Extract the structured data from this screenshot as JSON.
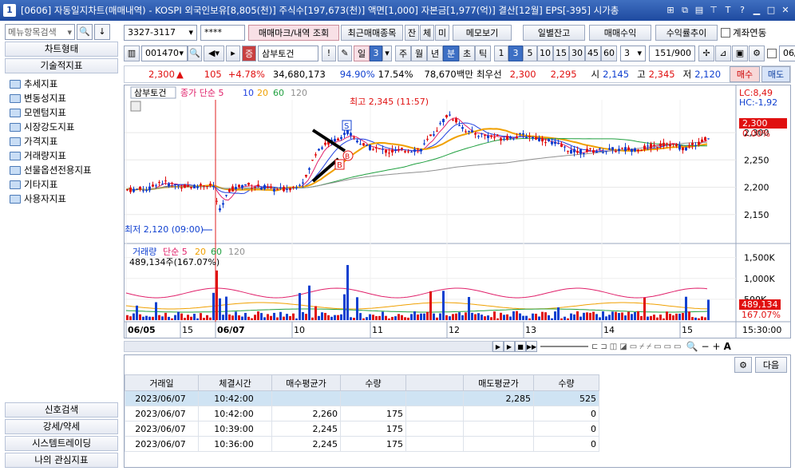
{
  "window": {
    "badge": "1",
    "title": "[0606] 자동일지차트(매매내역) - KOSPI 외국인보유[8,805(천)] 주식수[197,673(천)] 액면[1,000] 자본금[1,977(억)] 결산[12월] EPS[-395] 시가총"
  },
  "left": {
    "search_placeholder": "메뉴항목검색",
    "top_cats": [
      "차트형태",
      "기술적지표"
    ],
    "folders": [
      "추세지표",
      "변동성지표",
      "모멘텀지표",
      "시장강도지표",
      "가격지표",
      "거래량지표",
      "선물옵션전용지표",
      "기타지표",
      "사용자지표"
    ],
    "bottom_cats": [
      "신호검색",
      "강세/약세",
      "시스템트레이딩",
      "나의 관심지표"
    ]
  },
  "toolbar1": {
    "account": "3327-3117",
    "password": "****",
    "btn_trade_mark": "매매마크/내역 조회",
    "btn_recent": "최근매매종목",
    "btn_jan": "잔",
    "btn_che": "체",
    "btn_mi": "미",
    "btn_memo": "메모보기",
    "btn_daily": "일별잔고",
    "btn_profit": "매매수익",
    "btn_rate": "수익률추이",
    "chk_account": "계좌연동"
  },
  "toolbar2": {
    "code": "001470",
    "name": "삼부토건",
    "period_day": "일",
    "period_num": "3",
    "periods": [
      "주",
      "월",
      "년",
      "분",
      "초",
      "틱"
    ],
    "minutes": [
      "1",
      "3",
      "5",
      "10",
      "15",
      "30",
      "45",
      "60"
    ],
    "count": "3",
    "range": "151/900",
    "date": "06/07"
  },
  "quote": {
    "price": "2,300",
    "arrow": "▲",
    "change": "105",
    "pct": "+4.78%",
    "volume": "34,680,173",
    "ratio1": "94.90%",
    "ratio2": "17.54%",
    "amount": "78,670백만",
    "pref_label": "최우선",
    "ask": "2,300",
    "bid": "2,295",
    "open_label": "시",
    "open": "2,145",
    "high_label": "고",
    "high": "2,345",
    "low_label": "저",
    "low": "2,120",
    "buy_btn": "매수",
    "sell_btn": "매도"
  },
  "chart_labels": {
    "price_title": "삼부토건",
    "price_legend": "종가 단순 5",
    "ma10": "10",
    "ma20": "20",
    "ma60": "60",
    "ma120": "120",
    "lc": "LC:8,49",
    "hc": "HC:-1,92",
    "high_note": "최고 2,345 (11:57)",
    "low_note": "최저 2,120 (09:00)",
    "cur_price": "2,300",
    "cur_pct": "0.00%",
    "vol_title": "거래량",
    "vol_legend": "단순 5",
    "vol_value": "489,134주(167.07%)",
    "vol_cur": "489,134",
    "vol_pct": "167.07%",
    "time_right": "15:30:00",
    "sig_s": "S",
    "sig_b1": "B",
    "sig_b2": "B"
  },
  "chart_data": [
    {
      "type": "candlestick",
      "title": "삼부토건",
      "y_ticks": [
        2150,
        2200,
        2250,
        2300
      ],
      "ylim": [
        2100,
        2360
      ],
      "x_ticks": [
        "06/05",
        "15",
        "06/07",
        "10",
        "11",
        "12",
        "13",
        "14",
        "15"
      ],
      "series": [
        {
          "name": "종가 단순 5",
          "color": "#e0206a"
        },
        {
          "name": "10",
          "color": "#2040e0"
        },
        {
          "name": "20",
          "color": "#f0a000"
        },
        {
          "name": "60",
          "color": "#20a040"
        },
        {
          "name": "120",
          "color": "#909090"
        }
      ],
      "annotations": {
        "high": 2345,
        "low": 2120,
        "current": 2300
      }
    },
    {
      "type": "bar",
      "title": "거래량",
      "y_ticks": [
        "500K",
        "1,000K",
        "1,500K"
      ],
      "ylim": [
        0,
        1800000
      ],
      "current": 489134,
      "series": [
        {
          "name": "단순 5",
          "color": "#e0206a"
        },
        {
          "name": "20",
          "color": "#f0a000"
        },
        {
          "name": "60",
          "color": "#20a040"
        },
        {
          "name": "120",
          "color": "#909090"
        }
      ]
    }
  ],
  "chart_controls": {
    "next_btn": "다음"
  },
  "table": {
    "headers": [
      "거래일",
      "체결시간",
      "매수평균가",
      "수량",
      "",
      "매도평균가",
      "수량"
    ],
    "rows": [
      [
        "2023/06/07",
        "10:42:00",
        "",
        "",
        "",
        "2,285",
        "525"
      ],
      [
        "2023/06/07",
        "10:42:00",
        "2,260",
        "175",
        "",
        "",
        "0"
      ],
      [
        "2023/06/07",
        "10:39:00",
        "2,245",
        "175",
        "",
        "",
        "0"
      ],
      [
        "2023/06/07",
        "10:36:00",
        "2,245",
        "175",
        "",
        "",
        "0"
      ]
    ]
  },
  "colors": {
    "up": "#e01010",
    "down": "#1040d0",
    "titlebar": "#1e4aa0",
    "accent": "#3d6fc4"
  }
}
